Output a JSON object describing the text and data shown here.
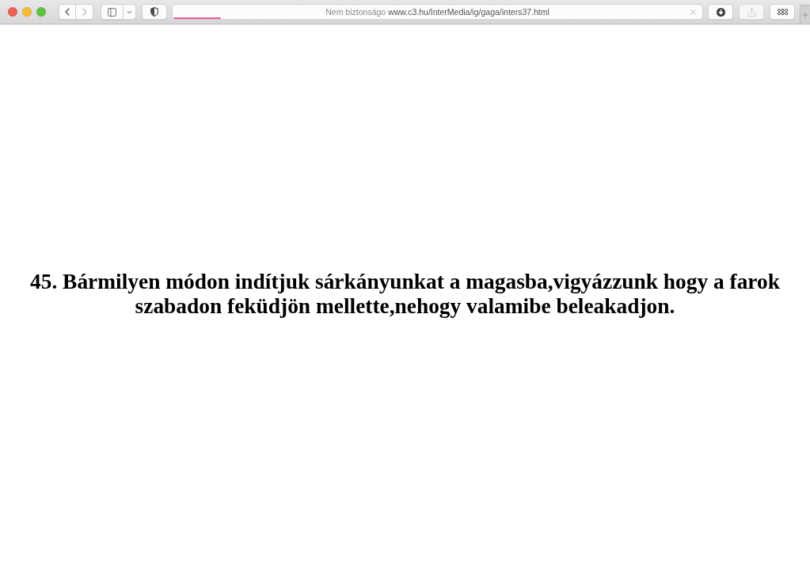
{
  "browser": {
    "nav_buttons": [
      {
        "kind": "back",
        "disabled": false
      },
      {
        "kind": "forward",
        "disabled": true
      }
    ],
    "address_bar": {
      "security_label": "Nem biztonságo",
      "url": "www.c3.hu/InterMedia/ig/gaga/inters37.html",
      "loading": {
        "level": 0.09
      }
    },
    "toolbar_buttons": [
      {
        "kind": "downloads",
        "disabled": false
      },
      {
        "kind": "share",
        "disabled": true
      },
      {
        "kind": "tabs",
        "disabled": false
      }
    ]
  },
  "page": {
    "heading": "45. Bármilyen módon indítjuk sárkányunkat a magasba,vigyázzunk hogy a farok szabadon feküdjön mellette,nehogy valamibe beleakadjon."
  }
}
